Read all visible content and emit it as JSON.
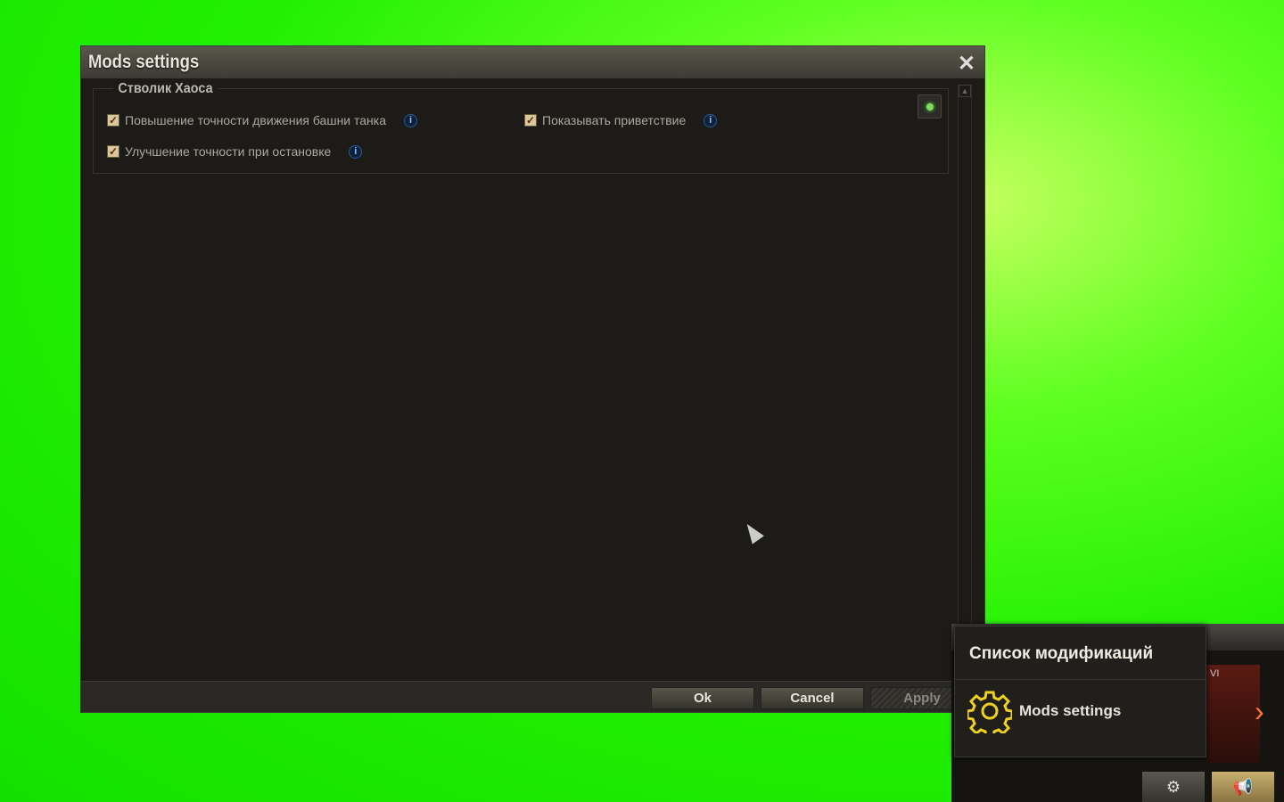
{
  "dialog": {
    "title": "Mods settings",
    "group": {
      "title": "Стволик Хаоса",
      "options": [
        {
          "label": "Повышение точности движения башни танка",
          "checked": true
        },
        {
          "label": "Показывать приветствие",
          "checked": true
        },
        {
          "label": "Улучшение точности при остановке",
          "checked": true
        }
      ]
    },
    "buttons": {
      "ok": "Ok",
      "cancel": "Cancel",
      "apply": "Apply"
    }
  },
  "popup": {
    "header": "Список модификаций",
    "item": "Mods settings"
  },
  "hud": {
    "tier": "VI"
  }
}
